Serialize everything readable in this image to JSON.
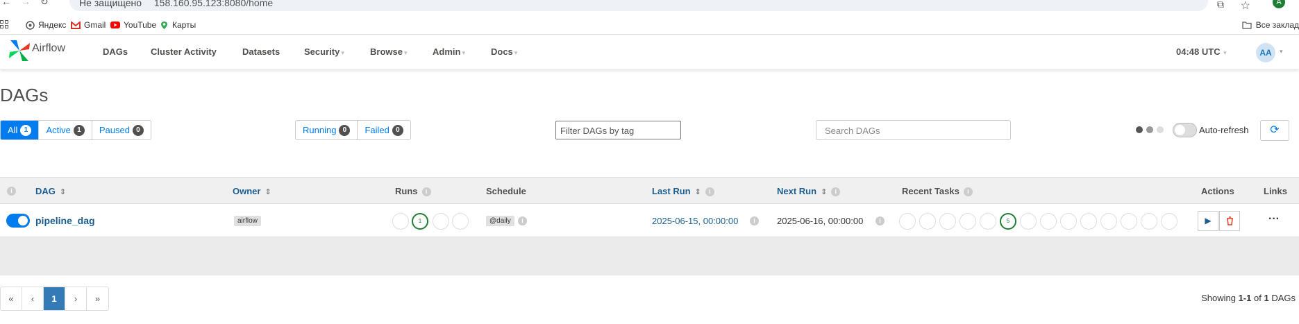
{
  "browser": {
    "url": "158.160.95.123:8080/home",
    "insecure_label": "Не защищено",
    "profile_initial": "A",
    "bookmarks": [
      "Яндекс",
      "Gmail",
      "YouTube",
      "Карты"
    ],
    "all_bookmarks_label": "Все заклад"
  },
  "nav": {
    "brand": "Airflow",
    "items": [
      "DAGs",
      "Cluster Activity",
      "Datasets",
      "Security",
      "Browse",
      "Admin",
      "Docs"
    ],
    "clock": "04:48 UTC",
    "user_initials": "AA"
  },
  "page": {
    "title": "DAGs"
  },
  "filters": {
    "status": [
      {
        "label": "All",
        "count": "1"
      },
      {
        "label": "Active",
        "count": "1"
      },
      {
        "label": "Paused",
        "count": "0"
      }
    ],
    "run_state": [
      {
        "label": "Running",
        "count": "0"
      },
      {
        "label": "Failed",
        "count": "0"
      }
    ],
    "tag_placeholder": "Filter DAGs by tag",
    "search_placeholder": "Search DAGs",
    "autorefresh_label": "Auto-refresh"
  },
  "table": {
    "headers": {
      "dag": "DAG",
      "owner": "Owner",
      "runs": "Runs",
      "schedule": "Schedule",
      "last_run": "Last Run",
      "next_run": "Next Run",
      "recent_tasks": "Recent Tasks",
      "actions": "Actions",
      "links": "Links"
    },
    "rows": [
      {
        "dag_id": "pipeline_dag",
        "owner": "airflow",
        "runs_success": "1",
        "schedule": "@daily",
        "last_run": "2025-06-15, 00:00:00",
        "next_run": "2025-06-16, 00:00:00",
        "recent_tasks_success": "5"
      }
    ]
  },
  "pagination": {
    "first": "«",
    "prev": "‹",
    "current": "1",
    "next": "›",
    "last": "»",
    "showing_prefix": "Showing",
    "showing_range": "1-1",
    "showing_of": "of",
    "showing_total": "1",
    "showing_suffix": "DAGs"
  }
}
